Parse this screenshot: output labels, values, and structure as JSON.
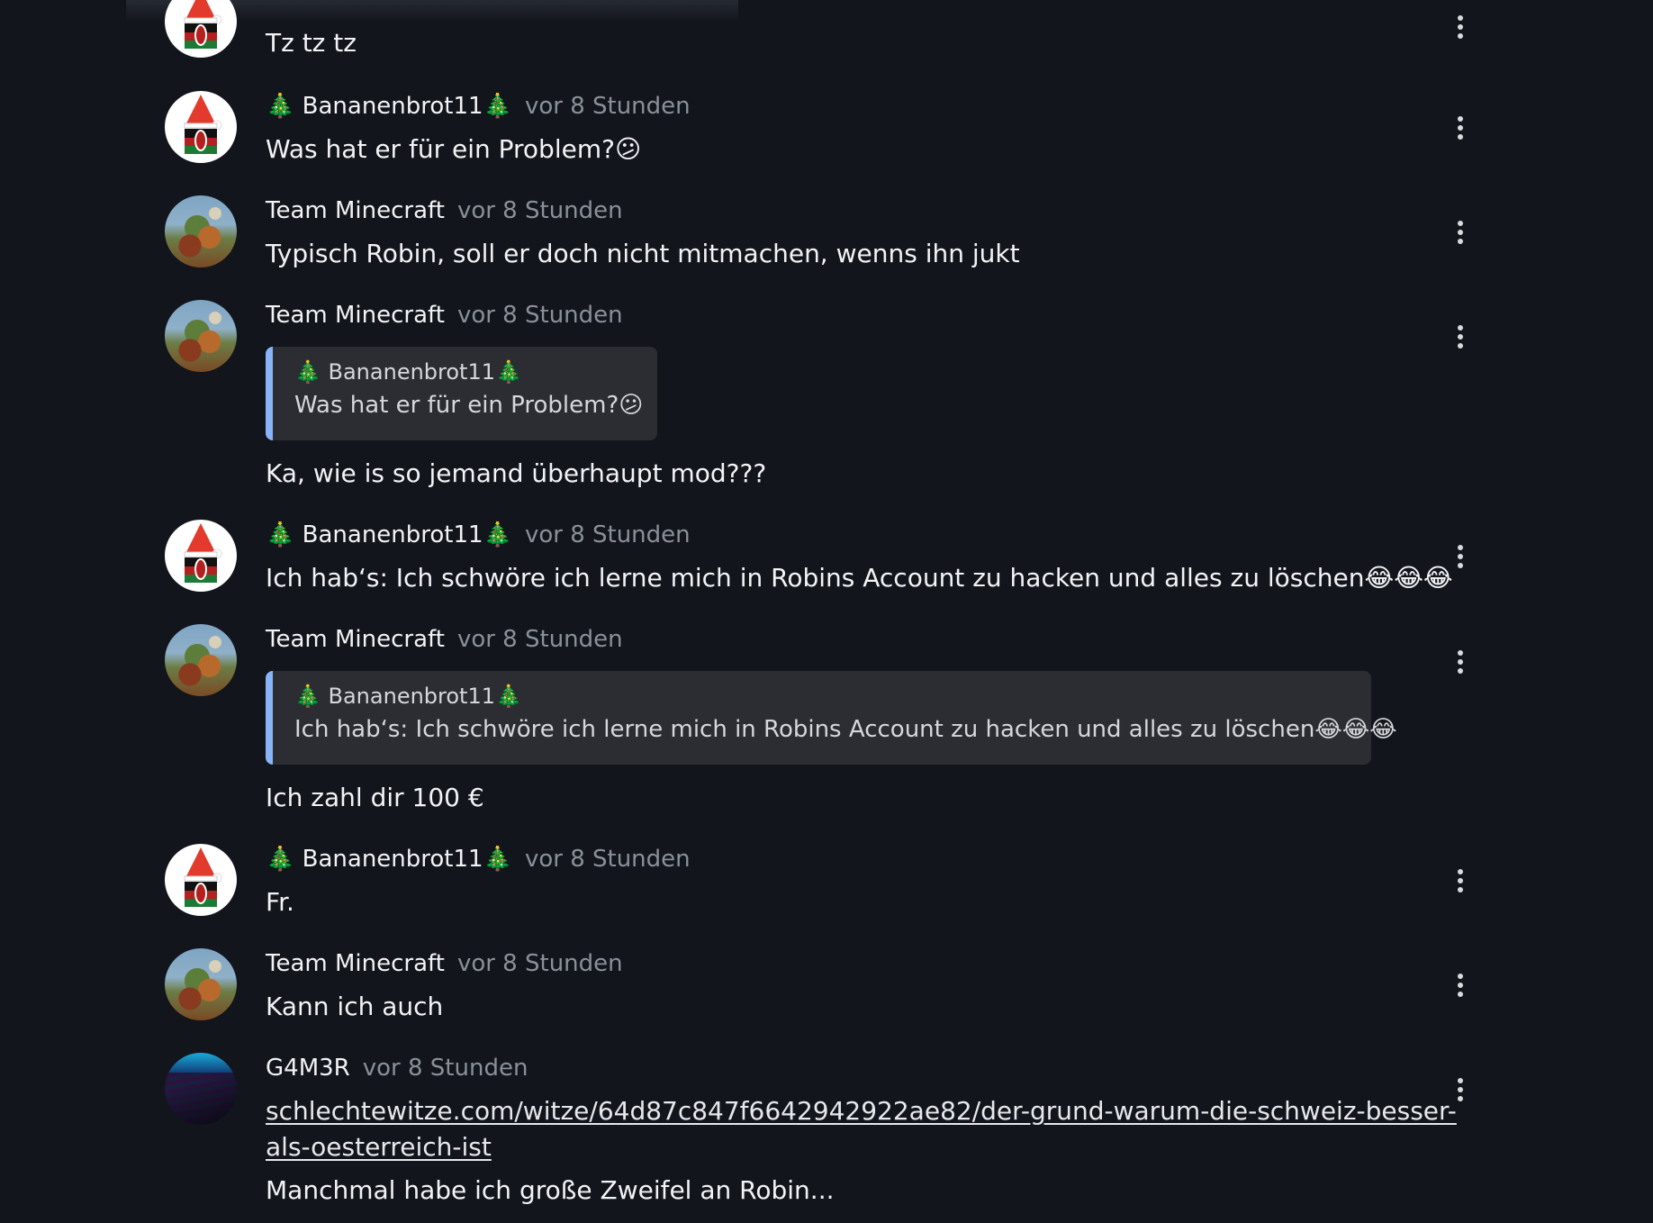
{
  "messages": [
    {
      "author": "",
      "time": "",
      "text": "Tz tz tz",
      "avatar": "banana"
    },
    {
      "author": "🎄 Bananenbrot11🎄",
      "time": "vor 8 Stunden",
      "text": "Was hat er für ein Problem?",
      "emoji": "😕",
      "avatar": "banana"
    },
    {
      "author": "Team Minecraft",
      "time": "vor 8 Stunden",
      "text": "Typisch Robin, soll er doch nicht mitmachen, wenns ihn jukt",
      "avatar": "team"
    },
    {
      "author": "Team Minecraft",
      "time": "vor 8 Stunden",
      "quote": {
        "author": "🎄 Bananenbrot11🎄",
        "text": "Was hat er für ein Problem?",
        "emoji": "😕"
      },
      "text": "Ka, wie is so jemand überhaupt mod???",
      "avatar": "team"
    },
    {
      "author": "🎄 Bananenbrot11🎄",
      "time": "vor 8 Stunden",
      "text": "Ich hab‘s: Ich schwöre ich lerne mich in Robins Account zu hacken und alles zu löschen",
      "emoji": "😂😂😂",
      "avatar": "banana"
    },
    {
      "author": "Team Minecraft",
      "time": "vor 8 Stunden",
      "quote": {
        "author": "🎄 Bananenbrot11🎄",
        "text": "Ich hab‘s: Ich schwöre ich lerne mich in Robins Account zu hacken und alles zu löschen",
        "emoji": "😂😂😂"
      },
      "text": "Ich zahl dir 100 €",
      "avatar": "team"
    },
    {
      "author": "🎄 Bananenbrot11🎄",
      "time": "vor 8 Stunden",
      "text": "Fr.",
      "avatar": "banana"
    },
    {
      "author": "Team Minecraft",
      "time": "vor 8 Stunden",
      "text": "Kann ich auch",
      "avatar": "team"
    },
    {
      "author": "G4M3R",
      "time": "vor 8 Stunden",
      "link_line1": "schlechtewitze.com/witze/64d87c847f6642942922ae82/der-grund-warum-die-schweiz-besser-",
      "link_line2": "als-oesterreich-ist",
      "text": "Manchmal habe ich große Zweifel an Robin...",
      "avatar": "g4m3r"
    }
  ],
  "colors": {
    "background": "#12151c",
    "quote_bar": "#8ab4f8",
    "quote_bg": "#2b2d33",
    "muted": "#8b9098"
  },
  "icons": {
    "menu": "more-vertical-icon"
  }
}
